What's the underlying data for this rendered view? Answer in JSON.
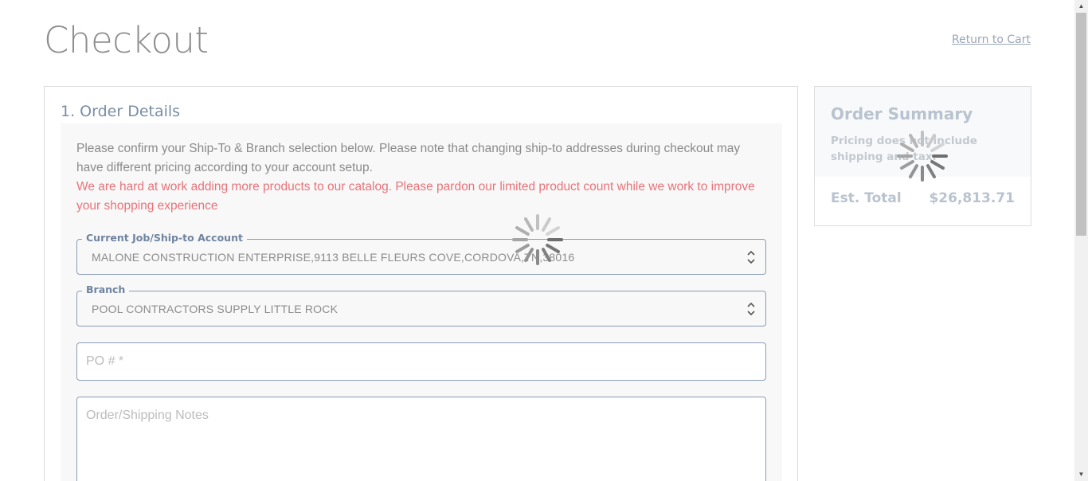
{
  "page": {
    "title": "Checkout",
    "return_link": "Return to Cart"
  },
  "order_details": {
    "heading": "1. Order Details",
    "intro": "Please confirm your Ship-To & Branch selection below. Please note that changing ship-to addresses during checkout may have different pricing according to your account setup.",
    "notice": "We are hard at work adding more products to our catalog. Please pardon our limited product count while we work to improve your shopping experience",
    "notice_color": "#e8737a",
    "account_select": {
      "label": "Current Job/Ship-to Account",
      "value": "MALONE CONSTRUCTION ENTERPRISE,9113 BELLE FLEURS COVE,CORDOVA,TN,38016"
    },
    "branch_select": {
      "label": "Branch",
      "value": "POOL CONTRACTORS SUPPLY LITTLE ROCK"
    },
    "po_input": {
      "placeholder": "PO # *"
    },
    "notes_input": {
      "placeholder": "Order/Shipping Notes"
    }
  },
  "order_summary": {
    "title": "Order Summary",
    "note": "Pricing does not include shipping and tax.",
    "est_total_label": "Est. Total",
    "est_total_value": "$26,813.71"
  },
  "icons": {
    "spinner": "loading-spinner-icon",
    "chevrons": "chevron-up-down-icon"
  }
}
